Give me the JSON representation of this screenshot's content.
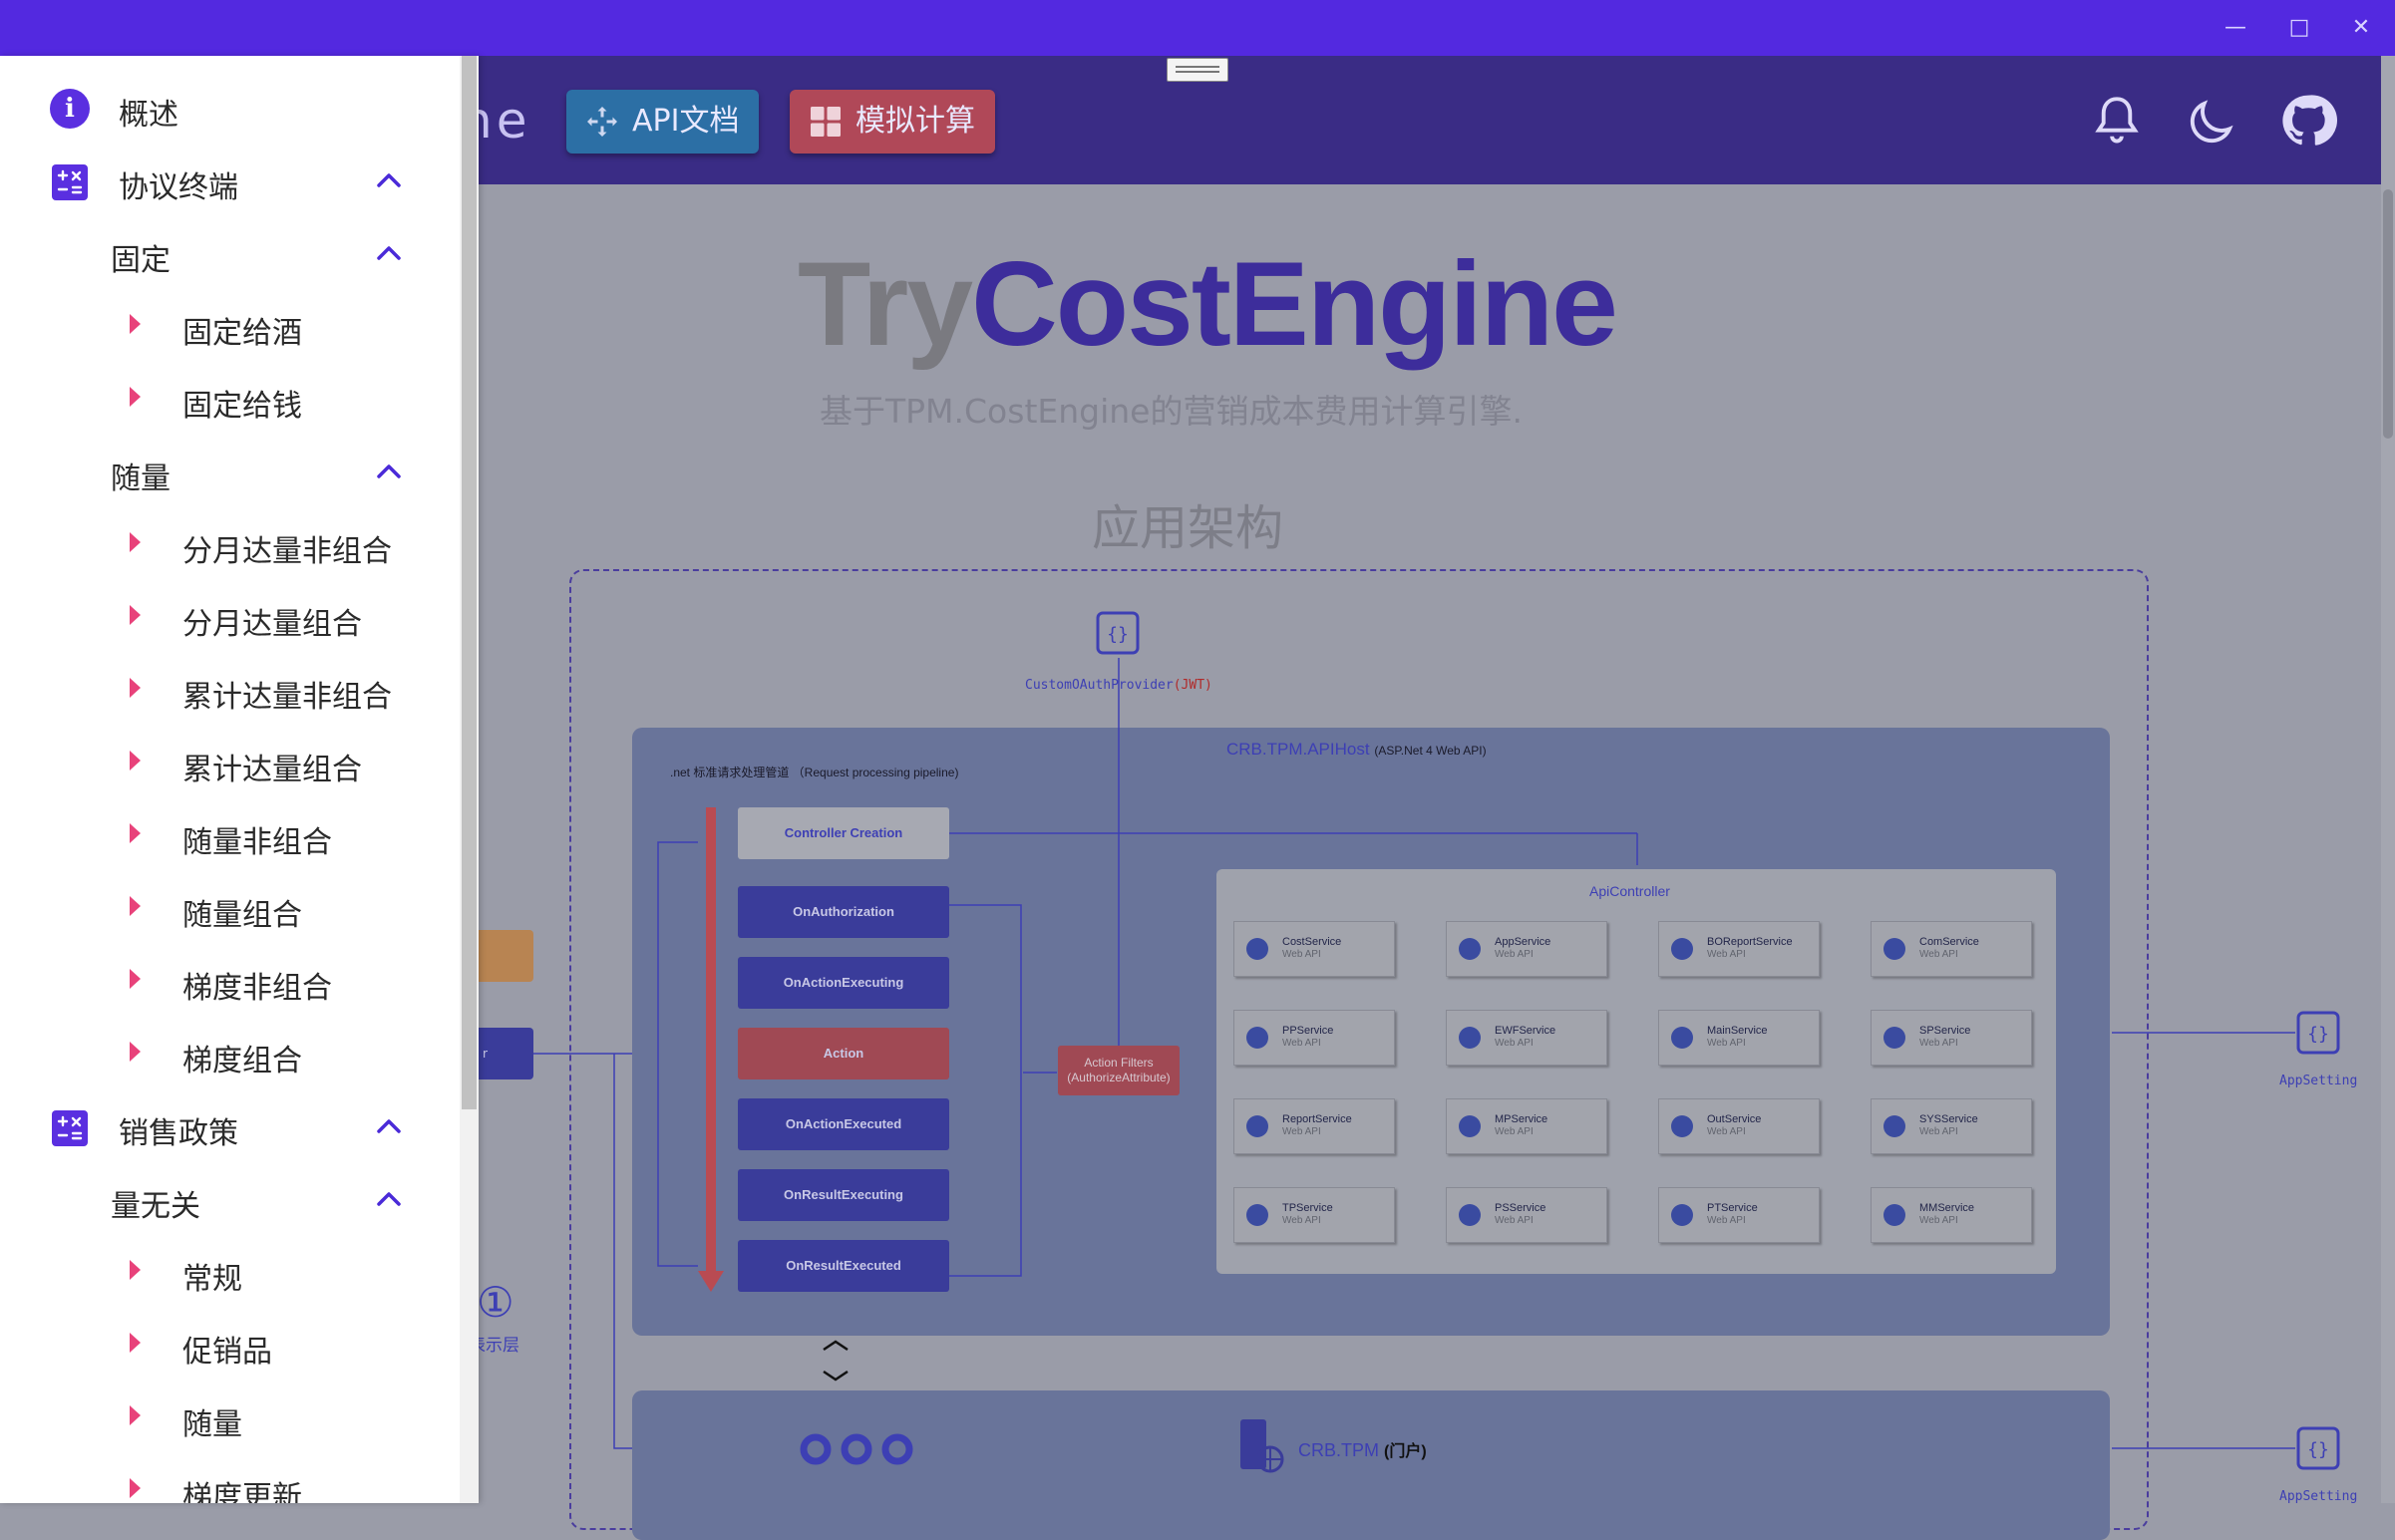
{
  "header": {
    "brand_fragment": "ne",
    "api_doc_label": "API文档",
    "simulate_label": "模拟计算"
  },
  "hero": {
    "title_a": "Try",
    "title_b": "CostEngine",
    "subtitle": "基于TPM.CostEngine的营销成本费用计算引擎.",
    "section_title": "应用架构"
  },
  "diagram": {
    "auth_provider": "CustomOAuthProvider",
    "auth_suffix": "(JWT)",
    "apihost_title": "CRB.TPM.APIHost",
    "apihost_suffix": "(ASP.Net 4 Web API)",
    "pipeline_label": ".net 标准请求处理管道 （Request processing pipeline)",
    "pipeline_steps": [
      "Controller Creation",
      "OnAuthorization",
      "OnActionExecuting",
      "Action",
      "OnActionExecuted",
      "OnResultExecuting",
      "OnResultExecuted"
    ],
    "filters_label_1": "Action Filters",
    "filters_label_2": "(AuthorizeAttribute)",
    "api_controller": "ApiController",
    "services": [
      "CostService",
      "AppService",
      "BOReportService",
      "ComService",
      "PPService",
      "EWFService",
      "MainService",
      "SPService",
      "ReportService",
      "MPService",
      "OutService",
      "SYSService",
      "TPService",
      "PSService",
      "PTService",
      "MMService"
    ],
    "service_sub": "Web API",
    "app_setting": "AppSetting",
    "layer_num": "①",
    "layer_label": "表示层",
    "portal_title": "CRB.TPM",
    "portal_suffix": "(门户)",
    "left_box_2": "r"
  },
  "sidebar": {
    "items": [
      {
        "label": "概述",
        "level": 0,
        "icon": "info-icon"
      },
      {
        "label": "协议终端",
        "level": 0,
        "icon": "calculator-icon",
        "expanded": true
      },
      {
        "label": "固定",
        "level": 1,
        "expanded": true
      },
      {
        "label": "固定给酒",
        "level": 2
      },
      {
        "label": "固定给钱",
        "level": 2
      },
      {
        "label": "随量",
        "level": 1,
        "expanded": true
      },
      {
        "label": "分月达量非组合",
        "level": 2
      },
      {
        "label": "分月达量组合",
        "level": 2
      },
      {
        "label": "累计达量非组合",
        "level": 2
      },
      {
        "label": "累计达量组合",
        "level": 2
      },
      {
        "label": "随量非组合",
        "level": 2
      },
      {
        "label": "随量组合",
        "level": 2
      },
      {
        "label": "梯度非组合",
        "level": 2
      },
      {
        "label": "梯度组合",
        "level": 2
      },
      {
        "label": "销售政策",
        "level": 0,
        "icon": "calculator-icon",
        "expanded": true
      },
      {
        "label": "量无关",
        "level": 1,
        "expanded": true
      },
      {
        "label": "常规",
        "level": 2
      },
      {
        "label": "促销品",
        "level": 2
      },
      {
        "label": "随量",
        "level": 2
      },
      {
        "label": "梯度更新",
        "level": 2
      }
    ]
  },
  "colors": {
    "titlebar": "#5329e0",
    "accent": "#5a2fe0",
    "bullet": "#e8427a"
  }
}
